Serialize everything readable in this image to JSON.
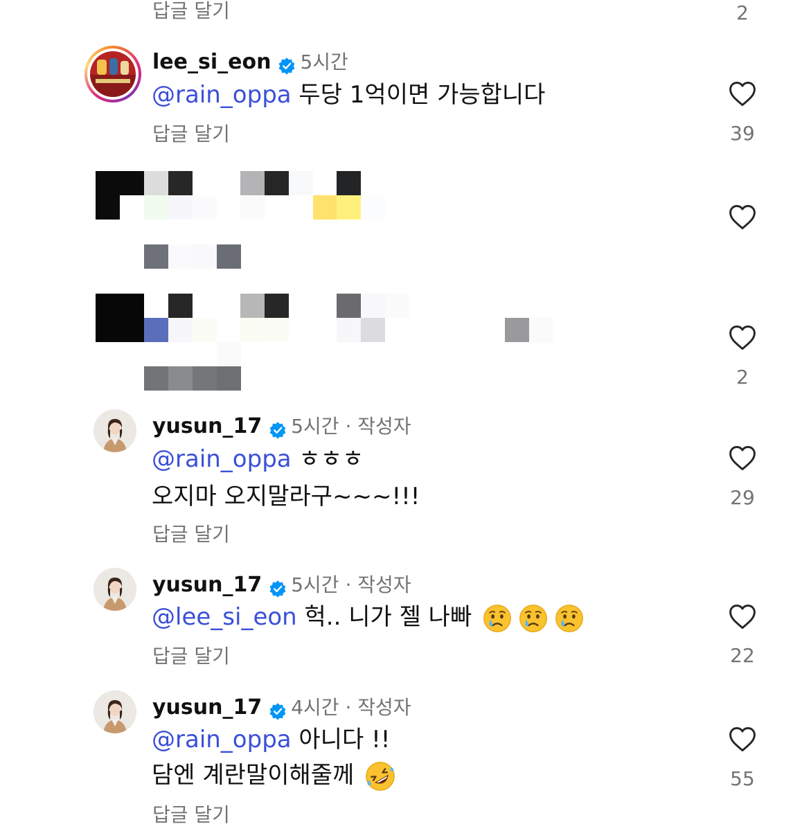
{
  "reply_label": "답글 달기",
  "top_partial": {
    "reply": "답글 달기",
    "likes": "2"
  },
  "comments": [
    {
      "username": "lee_si_eon",
      "time": "5시간",
      "author_tag": "",
      "mention": "@rain_oppa",
      "line1": " 두당 1억이면 가능합니다",
      "line2": "",
      "likes": "39"
    },
    {
      "username": "",
      "likes_top": "",
      "likes_bottom": "2",
      "censored": true
    },
    {
      "username": "yusun_17",
      "time": "5시간",
      "author_tag": " · 작성자",
      "mention": "@rain_oppa",
      "line1": "  ㅎㅎㅎ",
      "line2": "오지마 오지말라구~~~!!!",
      "likes": "29"
    },
    {
      "username": "yusun_17",
      "time": "5시간",
      "author_tag": " · 작성자",
      "mention": "@lee_si_eon",
      "line1": " 헉.. 니가 젤 나빠 ",
      "line2": "",
      "emoji": [
        "crying-face",
        "crying-face",
        "crying-face"
      ],
      "likes": "22"
    },
    {
      "username": "yusun_17",
      "time": "4시간",
      "author_tag": " · 작성자",
      "mention": "@rain_oppa",
      "line1": " 아니다 !!",
      "line2": "담엔 계란말이해줄께 ",
      "emoji": [
        "rolling-on-floor-laughing-face"
      ],
      "likes": "55"
    }
  ],
  "colors": {
    "mention": "#3a4fd8",
    "verified": "#0095f6",
    "muted": "#737373"
  }
}
